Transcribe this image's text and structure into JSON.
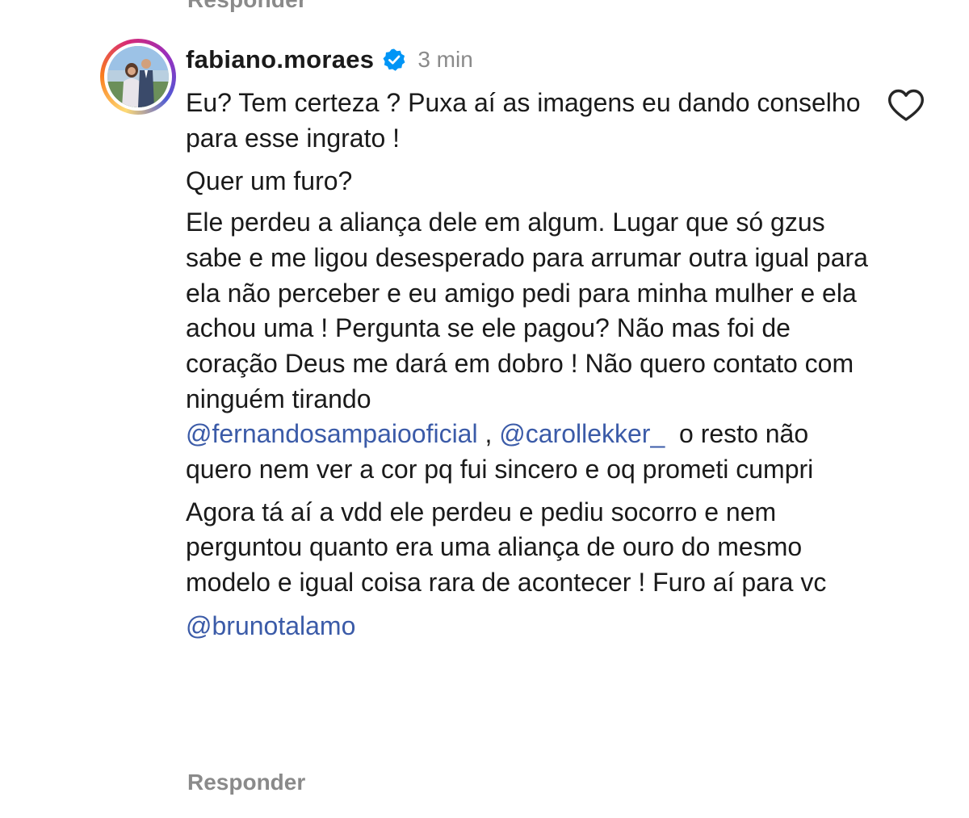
{
  "previous_comment": {
    "reply_label": "Responder"
  },
  "comment": {
    "username": "fabiano.moraes",
    "verified_icon": "verified-badge-icon",
    "timestamp": "3 min",
    "like_icon": "heart-icon",
    "paragraphs": {
      "p1": "Eu? Tem certeza ? Puxa aí as imagens eu dando conselho para esse ingrato !",
      "p2": "Quer um furo?",
      "p3_text": "Ele perdeu a aliança dele em algum. Lugar que só gzus sabe e me ligou desesperado para arrumar outra igual para ela não perceber e eu amigo pedi para minha mulher e ela achou uma ! Pergunta se ele pagou? Não mas foi de coração Deus me dará em dobro ! Não quero contato com ninguém tirando",
      "p3_mention1": "@fernandosampaiooficial",
      "p3_sep": " , ",
      "p3_mention2": "@carollekker_",
      "p3_tail": "  o resto não quero nem ver a cor pq fui sincero e oq prometi cumpri",
      "p4": "Agora tá aí a vdd ele perdeu e pediu socorro e nem perguntou quanto era uma aliança de ouro do mesmo modelo e igual coisa rara de acontecer ! Furo aí para vc",
      "p5_mention": "@brunotalamo"
    },
    "reply_label": "Responder"
  },
  "colors": {
    "text": "#1a1a1a",
    "secondary": "#8a8a8a",
    "mention": "#3b5ba8",
    "verified": "#0095f6"
  }
}
